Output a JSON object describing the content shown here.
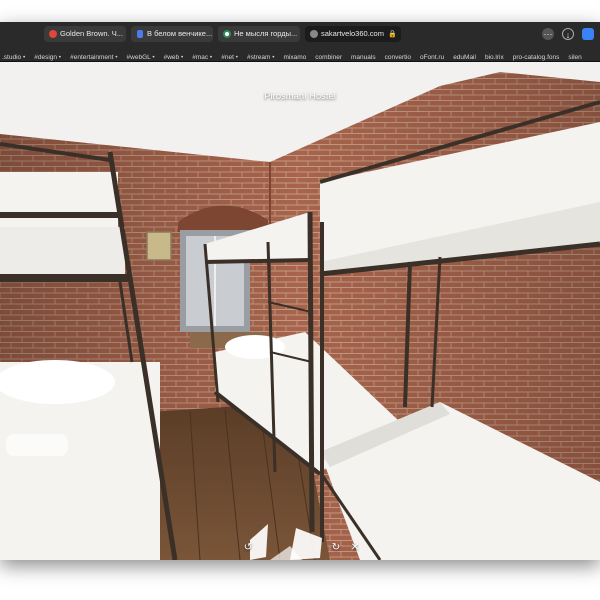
{
  "browser": {
    "tabs": [
      {
        "label": "Golden Brown. Ч...",
        "favicon_color": "#e0463b",
        "favicon": "pin-icon"
      },
      {
        "label": "В белом венчике...",
        "favicon_color": "#4a7cf0",
        "favicon": "mic-icon"
      },
      {
        "label": "Не мысля горды...",
        "favicon_color": "#ffffff",
        "favicon": "g-icon"
      },
      {
        "label": "sakartvelo360.com",
        "favicon_color": "#888888",
        "favicon": "globe-icon",
        "active": true
      }
    ],
    "toolbar_icons": [
      "more-icon",
      "download-icon",
      "extension-icon"
    ],
    "bookmarks": [
      ".studio •",
      "#design •",
      "#entertainment •",
      "#webGL •",
      "#web •",
      "#mac •",
      "#net •",
      "#stream •",
      "mixamo",
      "combiner",
      "manuals",
      "convertio",
      "oFont.ru",
      "eduMail",
      "bio.lrix",
      "pro-catalog.fons",
      "silen"
    ]
  },
  "viewer": {
    "title": "Pirosmani Hostel",
    "controls": [
      "rotate-left-icon",
      "rotate-right-icon",
      "close-icon"
    ]
  },
  "colors": {
    "brick": "#a8644c",
    "brick_dark": "#7c4632",
    "mortar": "#c49a84",
    "ceiling": "#f2f1ef",
    "bed_frame": "#3b3028",
    "sheet": "#f4f3f0",
    "floor": "#6a4a30"
  }
}
